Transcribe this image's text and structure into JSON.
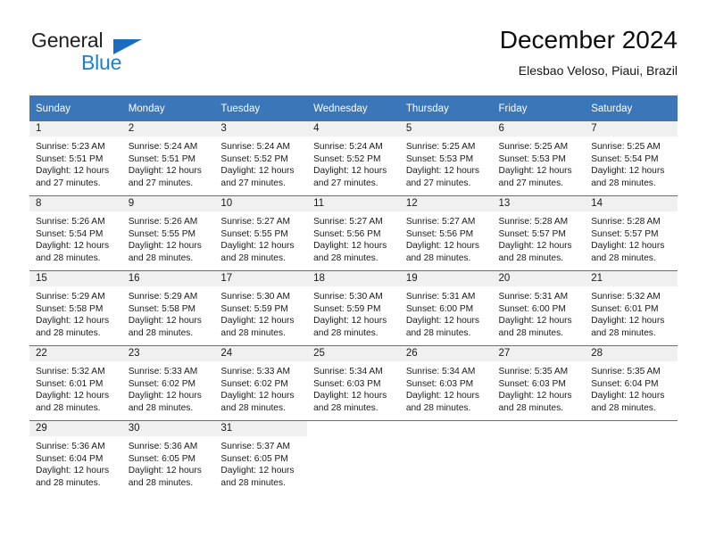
{
  "brand": {
    "name_part1": "General",
    "name_part2": "Blue",
    "triangle_color": "#1b6dc1",
    "blue_color": "#1b7fd4"
  },
  "header": {
    "title": "December 2024",
    "subtitle": "Elesbao Veloso, Piaui, Brazil"
  },
  "theme": {
    "header_bg": "#3a76b8",
    "daynum_bg": "#f0f0f0",
    "grid_line": "#3a76b8"
  },
  "weekdays": [
    "Sunday",
    "Monday",
    "Tuesday",
    "Wednesday",
    "Thursday",
    "Friday",
    "Saturday"
  ],
  "weeks": [
    [
      {
        "day": "1",
        "sunrise": "Sunrise: 5:23 AM",
        "sunset": "Sunset: 5:51 PM",
        "daylight1": "Daylight: 12 hours",
        "daylight2": "and 27 minutes."
      },
      {
        "day": "2",
        "sunrise": "Sunrise: 5:24 AM",
        "sunset": "Sunset: 5:51 PM",
        "daylight1": "Daylight: 12 hours",
        "daylight2": "and 27 minutes."
      },
      {
        "day": "3",
        "sunrise": "Sunrise: 5:24 AM",
        "sunset": "Sunset: 5:52 PM",
        "daylight1": "Daylight: 12 hours",
        "daylight2": "and 27 minutes."
      },
      {
        "day": "4",
        "sunrise": "Sunrise: 5:24 AM",
        "sunset": "Sunset: 5:52 PM",
        "daylight1": "Daylight: 12 hours",
        "daylight2": "and 27 minutes."
      },
      {
        "day": "5",
        "sunrise": "Sunrise: 5:25 AM",
        "sunset": "Sunset: 5:53 PM",
        "daylight1": "Daylight: 12 hours",
        "daylight2": "and 27 minutes."
      },
      {
        "day": "6",
        "sunrise": "Sunrise: 5:25 AM",
        "sunset": "Sunset: 5:53 PM",
        "daylight1": "Daylight: 12 hours",
        "daylight2": "and 27 minutes."
      },
      {
        "day": "7",
        "sunrise": "Sunrise: 5:25 AM",
        "sunset": "Sunset: 5:54 PM",
        "daylight1": "Daylight: 12 hours",
        "daylight2": "and 28 minutes."
      }
    ],
    [
      {
        "day": "8",
        "sunrise": "Sunrise: 5:26 AM",
        "sunset": "Sunset: 5:54 PM",
        "daylight1": "Daylight: 12 hours",
        "daylight2": "and 28 minutes."
      },
      {
        "day": "9",
        "sunrise": "Sunrise: 5:26 AM",
        "sunset": "Sunset: 5:55 PM",
        "daylight1": "Daylight: 12 hours",
        "daylight2": "and 28 minutes."
      },
      {
        "day": "10",
        "sunrise": "Sunrise: 5:27 AM",
        "sunset": "Sunset: 5:55 PM",
        "daylight1": "Daylight: 12 hours",
        "daylight2": "and 28 minutes."
      },
      {
        "day": "11",
        "sunrise": "Sunrise: 5:27 AM",
        "sunset": "Sunset: 5:56 PM",
        "daylight1": "Daylight: 12 hours",
        "daylight2": "and 28 minutes."
      },
      {
        "day": "12",
        "sunrise": "Sunrise: 5:27 AM",
        "sunset": "Sunset: 5:56 PM",
        "daylight1": "Daylight: 12 hours",
        "daylight2": "and 28 minutes."
      },
      {
        "day": "13",
        "sunrise": "Sunrise: 5:28 AM",
        "sunset": "Sunset: 5:57 PM",
        "daylight1": "Daylight: 12 hours",
        "daylight2": "and 28 minutes."
      },
      {
        "day": "14",
        "sunrise": "Sunrise: 5:28 AM",
        "sunset": "Sunset: 5:57 PM",
        "daylight1": "Daylight: 12 hours",
        "daylight2": "and 28 minutes."
      }
    ],
    [
      {
        "day": "15",
        "sunrise": "Sunrise: 5:29 AM",
        "sunset": "Sunset: 5:58 PM",
        "daylight1": "Daylight: 12 hours",
        "daylight2": "and 28 minutes."
      },
      {
        "day": "16",
        "sunrise": "Sunrise: 5:29 AM",
        "sunset": "Sunset: 5:58 PM",
        "daylight1": "Daylight: 12 hours",
        "daylight2": "and 28 minutes."
      },
      {
        "day": "17",
        "sunrise": "Sunrise: 5:30 AM",
        "sunset": "Sunset: 5:59 PM",
        "daylight1": "Daylight: 12 hours",
        "daylight2": "and 28 minutes."
      },
      {
        "day": "18",
        "sunrise": "Sunrise: 5:30 AM",
        "sunset": "Sunset: 5:59 PM",
        "daylight1": "Daylight: 12 hours",
        "daylight2": "and 28 minutes."
      },
      {
        "day": "19",
        "sunrise": "Sunrise: 5:31 AM",
        "sunset": "Sunset: 6:00 PM",
        "daylight1": "Daylight: 12 hours",
        "daylight2": "and 28 minutes."
      },
      {
        "day": "20",
        "sunrise": "Sunrise: 5:31 AM",
        "sunset": "Sunset: 6:00 PM",
        "daylight1": "Daylight: 12 hours",
        "daylight2": "and 28 minutes."
      },
      {
        "day": "21",
        "sunrise": "Sunrise: 5:32 AM",
        "sunset": "Sunset: 6:01 PM",
        "daylight1": "Daylight: 12 hours",
        "daylight2": "and 28 minutes."
      }
    ],
    [
      {
        "day": "22",
        "sunrise": "Sunrise: 5:32 AM",
        "sunset": "Sunset: 6:01 PM",
        "daylight1": "Daylight: 12 hours",
        "daylight2": "and 28 minutes."
      },
      {
        "day": "23",
        "sunrise": "Sunrise: 5:33 AM",
        "sunset": "Sunset: 6:02 PM",
        "daylight1": "Daylight: 12 hours",
        "daylight2": "and 28 minutes."
      },
      {
        "day": "24",
        "sunrise": "Sunrise: 5:33 AM",
        "sunset": "Sunset: 6:02 PM",
        "daylight1": "Daylight: 12 hours",
        "daylight2": "and 28 minutes."
      },
      {
        "day": "25",
        "sunrise": "Sunrise: 5:34 AM",
        "sunset": "Sunset: 6:03 PM",
        "daylight1": "Daylight: 12 hours",
        "daylight2": "and 28 minutes."
      },
      {
        "day": "26",
        "sunrise": "Sunrise: 5:34 AM",
        "sunset": "Sunset: 6:03 PM",
        "daylight1": "Daylight: 12 hours",
        "daylight2": "and 28 minutes."
      },
      {
        "day": "27",
        "sunrise": "Sunrise: 5:35 AM",
        "sunset": "Sunset: 6:03 PM",
        "daylight1": "Daylight: 12 hours",
        "daylight2": "and 28 minutes."
      },
      {
        "day": "28",
        "sunrise": "Sunrise: 5:35 AM",
        "sunset": "Sunset: 6:04 PM",
        "daylight1": "Daylight: 12 hours",
        "daylight2": "and 28 minutes."
      }
    ],
    [
      {
        "day": "29",
        "sunrise": "Sunrise: 5:36 AM",
        "sunset": "Sunset: 6:04 PM",
        "daylight1": "Daylight: 12 hours",
        "daylight2": "and 28 minutes."
      },
      {
        "day": "30",
        "sunrise": "Sunrise: 5:36 AM",
        "sunset": "Sunset: 6:05 PM",
        "daylight1": "Daylight: 12 hours",
        "daylight2": "and 28 minutes."
      },
      {
        "day": "31",
        "sunrise": "Sunrise: 5:37 AM",
        "sunset": "Sunset: 6:05 PM",
        "daylight1": "Daylight: 12 hours",
        "daylight2": "and 28 minutes."
      },
      {
        "day": "",
        "sunrise": "",
        "sunset": "",
        "daylight1": "",
        "daylight2": ""
      },
      {
        "day": "",
        "sunrise": "",
        "sunset": "",
        "daylight1": "",
        "daylight2": ""
      },
      {
        "day": "",
        "sunrise": "",
        "sunset": "",
        "daylight1": "",
        "daylight2": ""
      },
      {
        "day": "",
        "sunrise": "",
        "sunset": "",
        "daylight1": "",
        "daylight2": ""
      }
    ]
  ]
}
